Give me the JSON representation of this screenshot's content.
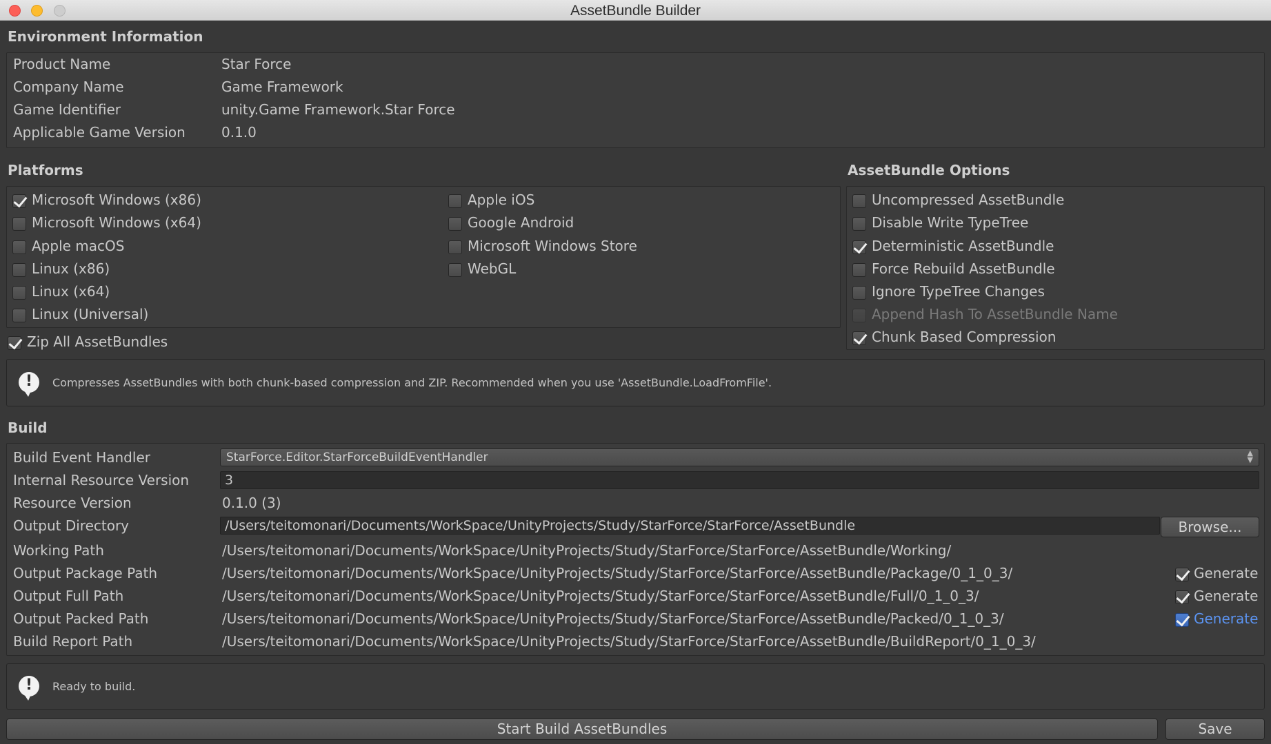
{
  "window": {
    "title": "AssetBundle Builder"
  },
  "environment": {
    "title": "Environment Information",
    "rows": [
      {
        "label": "Product Name",
        "value": "Star Force"
      },
      {
        "label": "Company Name",
        "value": "Game Framework"
      },
      {
        "label": "Game Identifier",
        "value": "unity.Game Framework.Star Force"
      },
      {
        "label": "Applicable Game Version",
        "value": "0.1.0"
      }
    ]
  },
  "platforms": {
    "title": "Platforms",
    "col1": [
      {
        "label": "Microsoft Windows (x86)",
        "checked": true
      },
      {
        "label": "Microsoft Windows (x64)",
        "checked": false
      },
      {
        "label": "Apple macOS",
        "checked": false
      },
      {
        "label": "Linux (x86)",
        "checked": false
      },
      {
        "label": "Linux (x64)",
        "checked": false
      },
      {
        "label": "Linux (Universal)",
        "checked": false
      }
    ],
    "col2": [
      {
        "label": "Apple iOS",
        "checked": false
      },
      {
        "label": "Google Android",
        "checked": false
      },
      {
        "label": "Microsoft Windows Store",
        "checked": false
      },
      {
        "label": "WebGL",
        "checked": false
      }
    ],
    "zip_all": {
      "label": "Zip All AssetBundles",
      "checked": true
    }
  },
  "options": {
    "title": "AssetBundle Options",
    "items": [
      {
        "label": "Uncompressed AssetBundle",
        "checked": false,
        "enabled": true
      },
      {
        "label": "Disable Write TypeTree",
        "checked": false,
        "enabled": true
      },
      {
        "label": "Deterministic AssetBundle",
        "checked": true,
        "enabled": true
      },
      {
        "label": "Force Rebuild AssetBundle",
        "checked": false,
        "enabled": true
      },
      {
        "label": "Ignore TypeTree Changes",
        "checked": false,
        "enabled": true
      },
      {
        "label": "Append Hash To AssetBundle Name",
        "checked": false,
        "enabled": false
      },
      {
        "label": "Chunk Based Compression",
        "checked": true,
        "enabled": true
      }
    ]
  },
  "compression_help": {
    "icon": "info-icon",
    "text": "Compresses AssetBundles with both chunk-based compression and ZIP. Recommended when you use 'AssetBundle.LoadFromFile'."
  },
  "build": {
    "title": "Build",
    "build_event_handler": {
      "label": "Build Event Handler",
      "value": "StarForce.Editor.StarForceBuildEventHandler"
    },
    "internal_resource_version": {
      "label": "Internal Resource Version",
      "value": "3"
    },
    "resource_version": {
      "label": "Resource Version",
      "value": "0.1.0 (3)"
    },
    "output_directory": {
      "label": "Output Directory",
      "value": "/Users/teitomonari/Documents/WorkSpace/UnityProjects/Study/StarForce/StarForce/AssetBundle",
      "browse_label": "Browse..."
    },
    "working_path": {
      "label": "Working Path",
      "value": "/Users/teitomonari/Documents/WorkSpace/UnityProjects/Study/StarForce/StarForce/AssetBundle/Working/"
    },
    "output_package_path": {
      "label": "Output Package Path",
      "value": "/Users/teitomonari/Documents/WorkSpace/UnityProjects/Study/StarForce/StarForce/AssetBundle/Package/0_1_0_3/",
      "generate_label": "Generate",
      "generate": true
    },
    "output_full_path": {
      "label": "Output Full Path",
      "value": "/Users/teitomonari/Documents/WorkSpace/UnityProjects/Study/StarForce/StarForce/AssetBundle/Full/0_1_0_3/",
      "generate_label": "Generate",
      "generate": true
    },
    "output_packed_path": {
      "label": "Output Packed Path",
      "value": "/Users/teitomonari/Documents/WorkSpace/UnityProjects/Study/StarForce/StarForce/AssetBundle/Packed/0_1_0_3/",
      "generate_label": "Generate",
      "generate": true
    },
    "build_report_path": {
      "label": "Build Report Path",
      "value": "/Users/teitomonari/Documents/WorkSpace/UnityProjects/Study/StarForce/StarForce/AssetBundle/BuildReport/0_1_0_3/"
    }
  },
  "status_help": {
    "icon": "info-icon",
    "text": "Ready to build."
  },
  "footer": {
    "start_build_label": "Start Build AssetBundles",
    "save_label": "Save"
  },
  "colors": {
    "background": "#383838",
    "accent_blue": "#5b93f0",
    "text": "#c8c8c8"
  }
}
